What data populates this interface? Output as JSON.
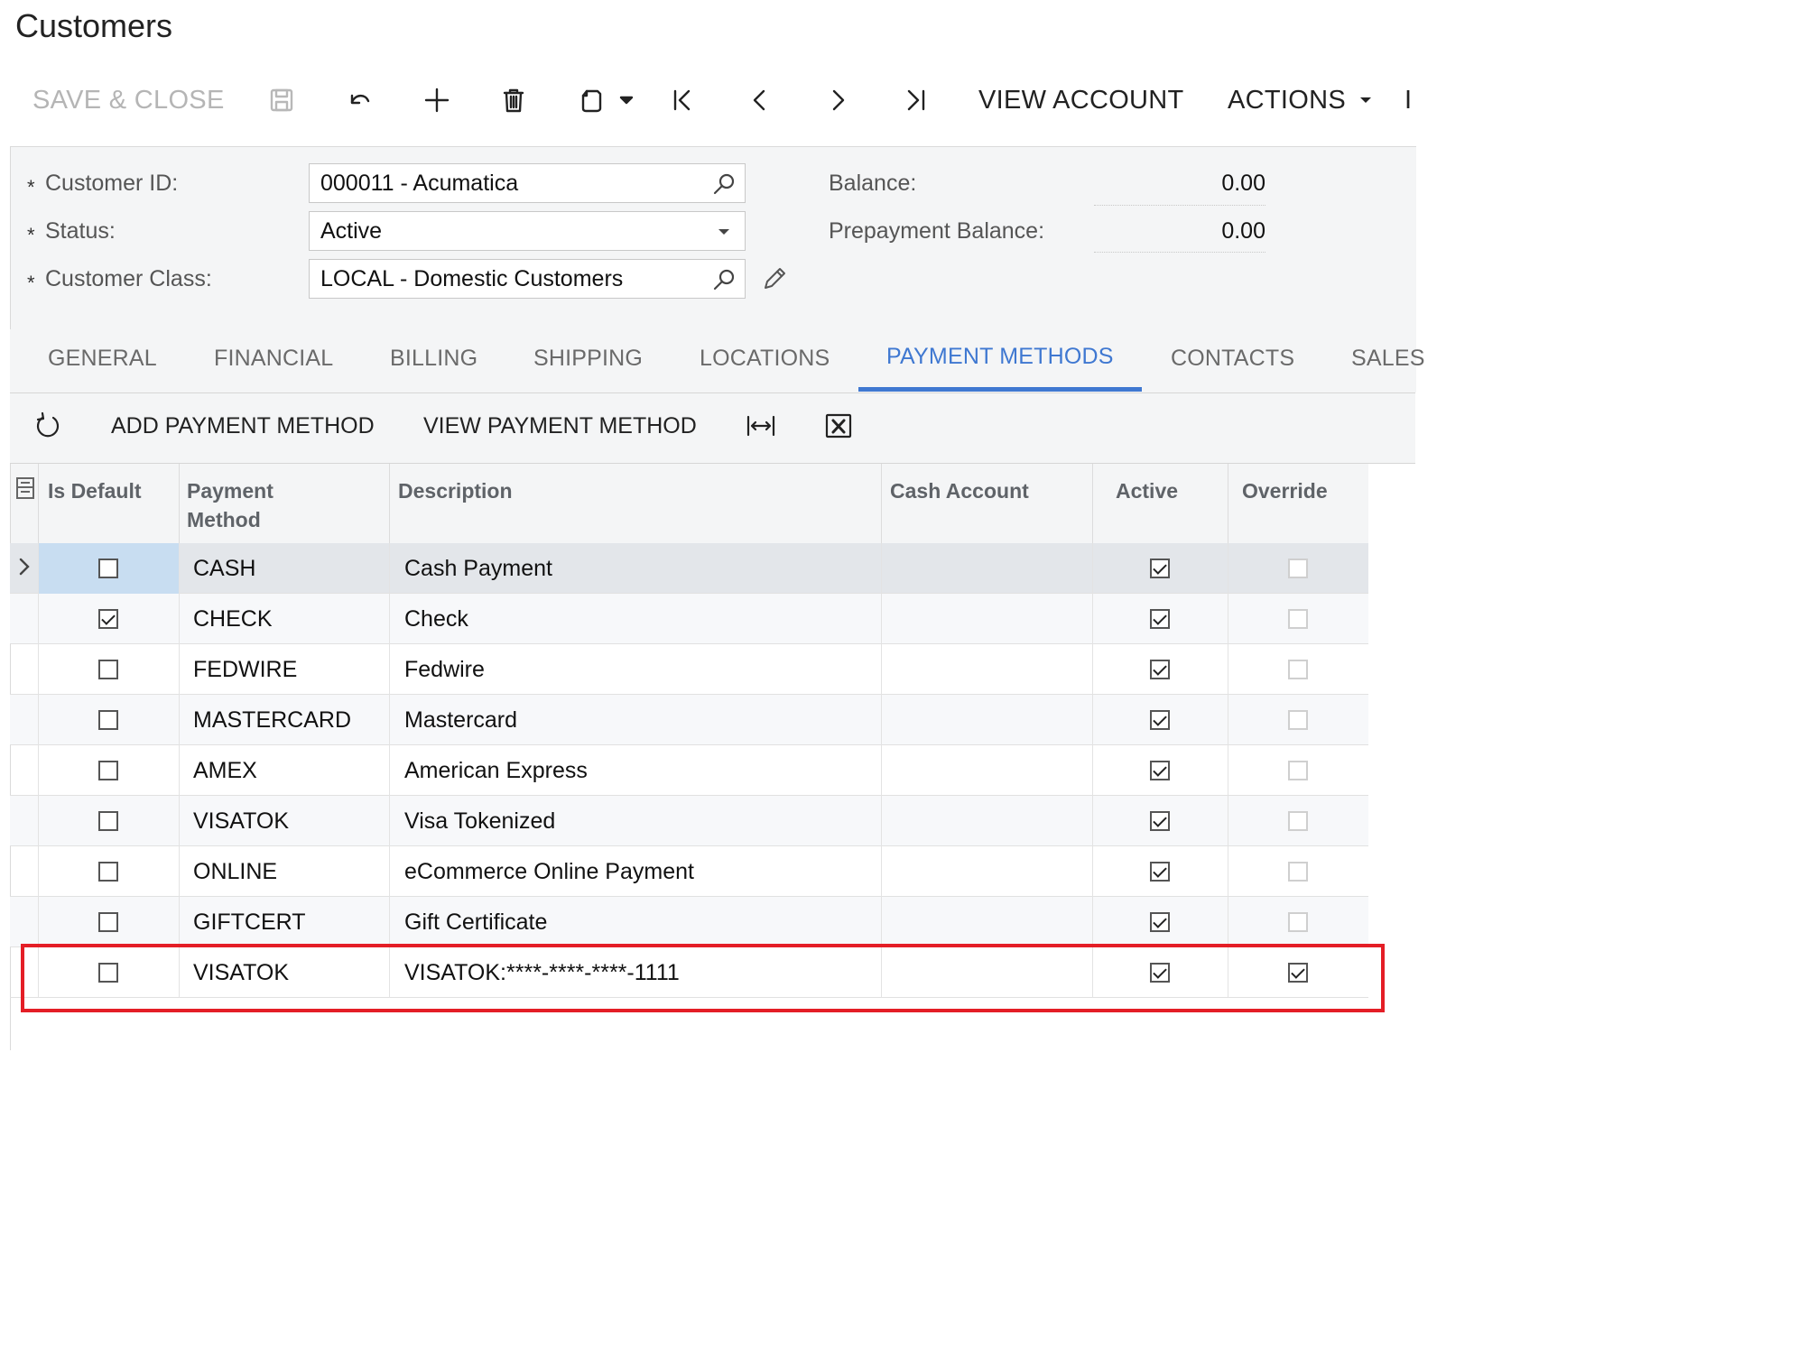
{
  "page": {
    "title": "Customers"
  },
  "toolbar": {
    "save_close": "SAVE & CLOSE",
    "view_account": "VIEW ACCOUNT",
    "actions": "ACTIONS",
    "overflow": "I"
  },
  "form": {
    "customer_id_label": "Customer ID:",
    "customer_id_value": "000011 - Acumatica",
    "status_label": "Status:",
    "status_value": "Active",
    "customer_class_label": "Customer Class:",
    "customer_class_value": "LOCAL - Domestic Customers",
    "balance_label": "Balance:",
    "balance_value": "0.00",
    "prepayment_balance_label": "Prepayment Balance:",
    "prepayment_balance_value": "0.00",
    "required_marker": "*"
  },
  "tabs": [
    "GENERAL",
    "FINANCIAL",
    "BILLING",
    "SHIPPING",
    "LOCATIONS",
    "PAYMENT METHODS",
    "CONTACTS",
    "SALES"
  ],
  "active_tab": "PAYMENT METHODS",
  "grid_toolbar": {
    "add_payment_method": "ADD PAYMENT METHOD",
    "view_payment_method": "VIEW PAYMENT METHOD"
  },
  "grid": {
    "columns": {
      "is_default": "Is Default",
      "payment_method": "Payment Method",
      "description": "Description",
      "cash_account": "Cash Account",
      "active": "Active",
      "override": "Override"
    },
    "rows": [
      {
        "is_default": false,
        "payment_method": "CASH",
        "description": "Cash Payment",
        "cash_account": "",
        "active": true,
        "override": false
      },
      {
        "is_default": true,
        "payment_method": "CHECK",
        "description": "Check",
        "cash_account": "",
        "active": true,
        "override": false
      },
      {
        "is_default": false,
        "payment_method": "FEDWIRE",
        "description": "Fedwire",
        "cash_account": "",
        "active": true,
        "override": false
      },
      {
        "is_default": false,
        "payment_method": "MASTERCARD",
        "description": "Mastercard",
        "cash_account": "",
        "active": true,
        "override": false
      },
      {
        "is_default": false,
        "payment_method": "AMEX",
        "description": "American Express",
        "cash_account": "",
        "active": true,
        "override": false
      },
      {
        "is_default": false,
        "payment_method": "VISATOK",
        "description": "Visa Tokenized",
        "cash_account": "",
        "active": true,
        "override": false
      },
      {
        "is_default": false,
        "payment_method": "ONLINE",
        "description": "eCommerce Online Payment",
        "cash_account": "",
        "active": true,
        "override": false
      },
      {
        "is_default": false,
        "payment_method": "GIFTCERT",
        "description": "Gift Certificate",
        "cash_account": "",
        "active": true,
        "override": false
      },
      {
        "is_default": false,
        "payment_method": "VISATOK",
        "description": "VISATOK:****-****-****-1111",
        "cash_account": "",
        "active": true,
        "override": true
      }
    ]
  },
  "colors": {
    "accent": "#3f78d1",
    "highlight_border": "#e41e26",
    "selected_row": "#e3e6ea"
  },
  "icons": [
    "save-icon",
    "undo-icon",
    "add-icon",
    "delete-icon",
    "copy-paste-icon",
    "first-record-icon",
    "previous-record-icon",
    "next-record-icon",
    "last-record-icon",
    "search-icon",
    "dropdown-arrow-icon",
    "edit-icon",
    "refresh-icon",
    "fit-to-screen-icon",
    "export-excel-icon",
    "row-selector-icon",
    "chevron-right-icon"
  ]
}
